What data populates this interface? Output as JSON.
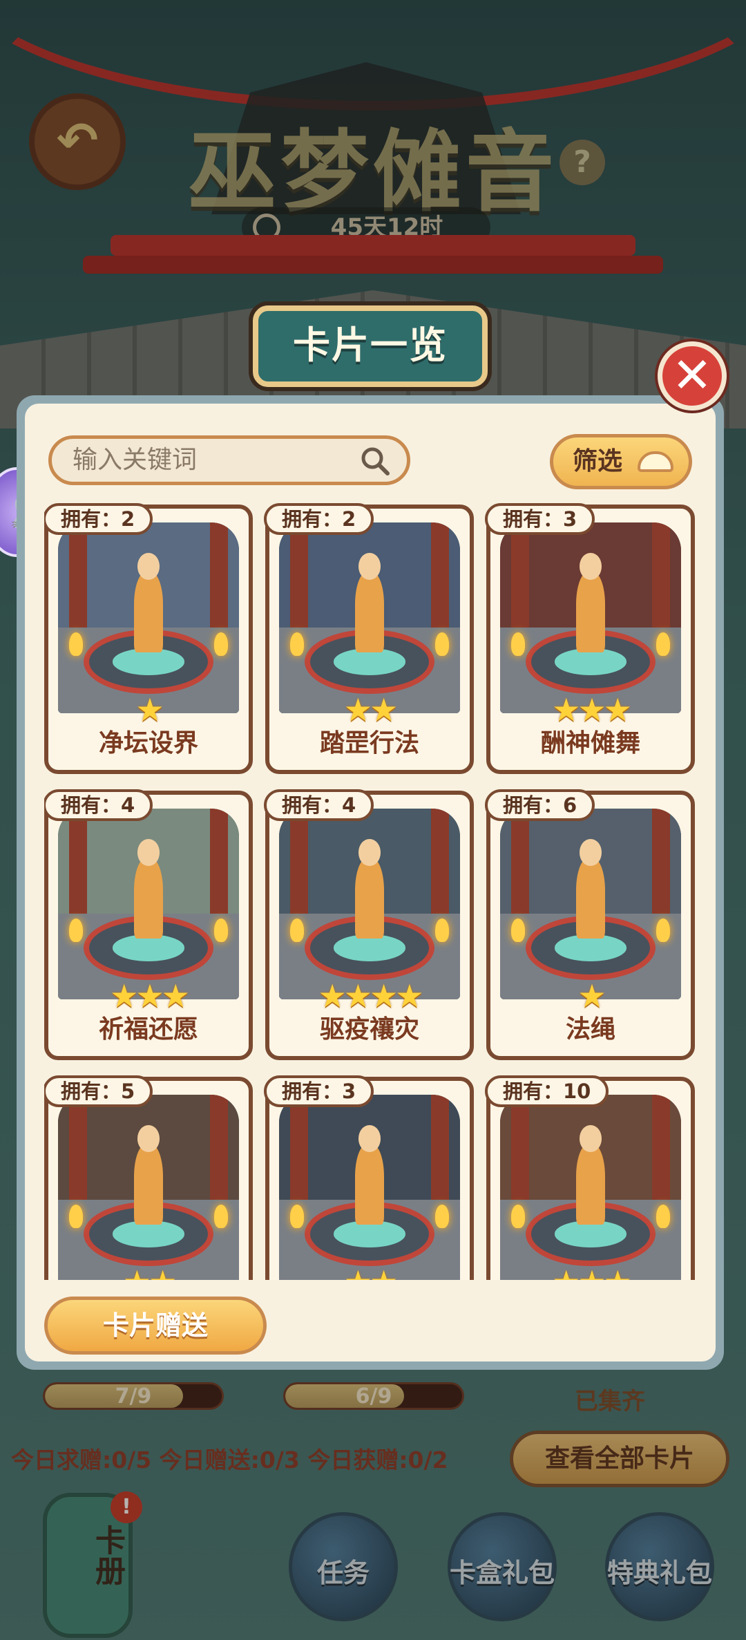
{
  "event": {
    "title": "巫梦傩音",
    "countdown": "45天12时",
    "back_icon": "back-arrow-icon",
    "help_label": "?"
  },
  "modal": {
    "title": "卡片一览",
    "close_label": "✕",
    "search": {
      "placeholder": "输入关键词"
    },
    "filter_label": "筛选",
    "gift_button": "卡片赠送",
    "cards": [
      {
        "name": "净坛设界",
        "owned": "拥有：2",
        "stars": 1,
        "stars_text": "★",
        "scene": "#5a6b82"
      },
      {
        "name": "踏罡行法",
        "owned": "拥有：2",
        "stars": 2,
        "stars_text": "★★",
        "scene": "#4b5c74"
      },
      {
        "name": "酬神傩舞",
        "owned": "拥有：3",
        "stars": 3,
        "stars_text": "★★★",
        "scene": "#6a3a34"
      },
      {
        "name": "祈福还愿",
        "owned": "拥有：4",
        "stars": 3,
        "stars_text": "★★★",
        "scene": "#7a8a7e"
      },
      {
        "name": "驱疫禳灾",
        "owned": "拥有：4",
        "stars": 4,
        "stars_text": "★★★★",
        "scene": "#4a5a66"
      },
      {
        "name": "法绳",
        "owned": "拥有：6",
        "stars": 1,
        "stars_text": "★",
        "scene": "#55606c"
      },
      {
        "name": "",
        "owned": "拥有：5",
        "stars": 2,
        "stars_text": "★★",
        "scene": "#5c4a40"
      },
      {
        "name": "",
        "owned": "拥有：3",
        "stars": 2,
        "stars_text": "★★",
        "scene": "#3f4a56"
      },
      {
        "name": "",
        "owned": "拥有：10",
        "stars": 3,
        "stars_text": "★★★",
        "scene": "#6a4a3a"
      }
    ]
  },
  "background": {
    "progress": [
      {
        "text": "7/9",
        "fraction": 0.78
      },
      {
        "text": "6/9",
        "fraction": 0.67
      }
    ],
    "collected_label": "已集齐",
    "daily_stats": "今日求赠:0/5 今日赠送:0/3 今日获赠:0/2",
    "view_all_button": "查看全部卡片",
    "album_label": "卡册",
    "album_badge": "!",
    "nav": [
      "任务",
      "卡盒礼包",
      "特典礼包"
    ]
  },
  "colors": {
    "accent": "#f0b451",
    "frame": "#7a4a30",
    "panel": "#f8f1e0",
    "title_bar": "#2f6d6b",
    "close": "#d6423a"
  }
}
